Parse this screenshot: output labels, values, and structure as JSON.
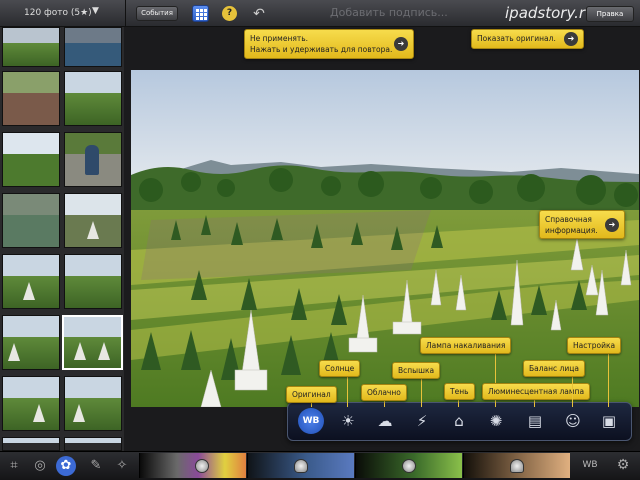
{
  "topbar": {
    "photo_count": "120 фото (5",
    "photo_count_suffix": ")",
    "events_label": "События",
    "caption_placeholder": "Добавить подпись...",
    "watermark": "ipadstory.ru",
    "done_label": "Правка"
  },
  "tooltips": {
    "undo": {
      "line1": "Не применять.",
      "line2": "Нажать и удерживать для повтора."
    },
    "original": "Показать оригинал.",
    "help": {
      "line1": "Справочная",
      "line2": "информация."
    }
  },
  "palette": {
    "labels": {
      "original": "Оригинал",
      "sun": "Солнце",
      "cloudy": "Облачно",
      "flash": "Вспышка",
      "incandescent": "Лампа накаливания",
      "shade": "Тень",
      "fluorescent": "Люминесцентная лампа",
      "face": "Баланс лица",
      "custom": "Настройка"
    },
    "active_icon_text": "WB"
  },
  "bottombar": {
    "wb_label": "WB"
  },
  "colors": {
    "accent": "#3c6ad4",
    "tooltip_yellow": "#f2cf3a",
    "bar_dark": "#1b1b1d"
  },
  "icons": [
    "crop-icon",
    "redeye-icon",
    "palette-icon",
    "brush-icon",
    "effects-icon",
    "chevron-down-icon",
    "grid-icon",
    "help-icon",
    "undo-icon",
    "gear-icon"
  ]
}
